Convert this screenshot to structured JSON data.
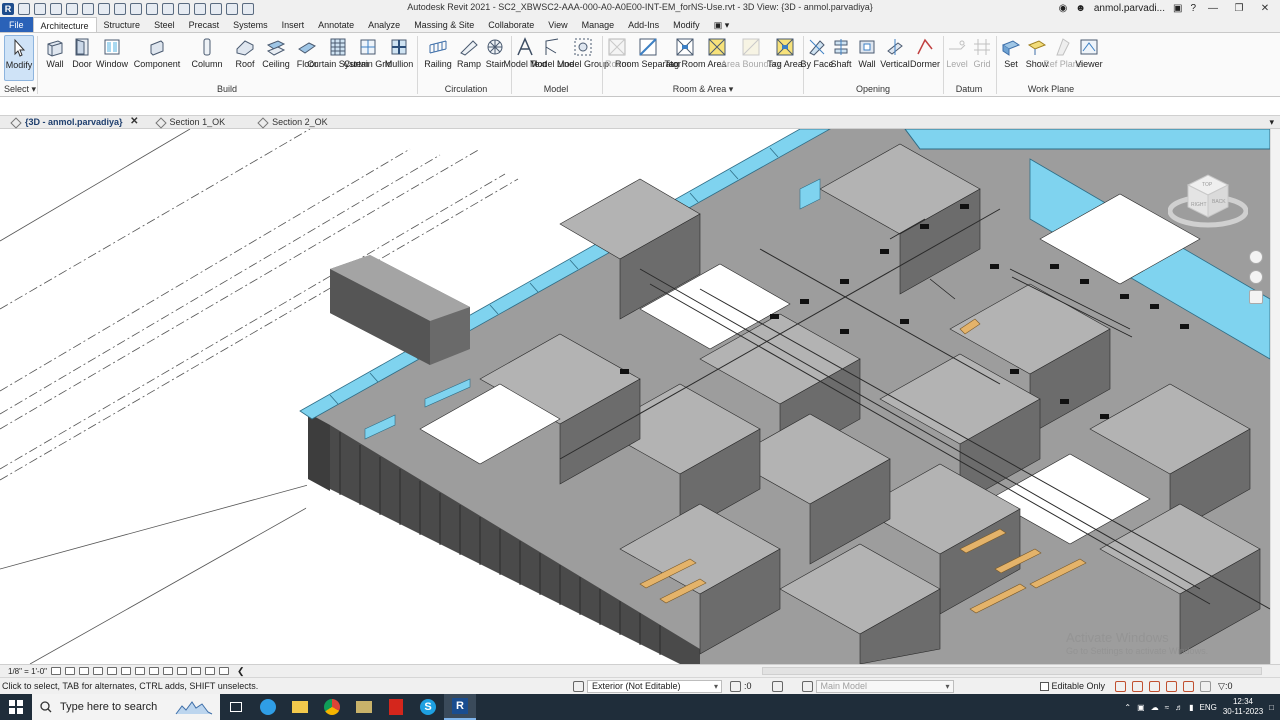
{
  "window": {
    "title": "Autodesk Revit 2021 - SC2_XBWSC2-AAA-000-A0-A0E00-INT-EM_forNS-Use.rvt - 3D View: {3D - anmol.parvadiya}",
    "user": "anmol.parvadi..."
  },
  "ribbon_tabs": [
    "File",
    "Architecture",
    "Structure",
    "Steel",
    "Precast",
    "Systems",
    "Insert",
    "Annotate",
    "Analyze",
    "Massing & Site",
    "Collaborate",
    "View",
    "Manage",
    "Add-Ins",
    "Modify"
  ],
  "active_tab": "Architecture",
  "ribbon": {
    "select": {
      "modify": "Modify",
      "label": "Select"
    },
    "build": {
      "label": "Build",
      "wall": "Wall",
      "door": "Door",
      "window": "Window",
      "component": "Component",
      "column": "Column",
      "roof": "Roof",
      "ceiling": "Ceiling",
      "floor": "Floor",
      "curtain_system": "Curtain System",
      "curtain_grid": "Curtain Grid",
      "mullion": "Mullion"
    },
    "circulation": {
      "label": "Circulation",
      "railing": "Railing",
      "ramp": "Ramp",
      "stair": "Stair"
    },
    "model": {
      "label": "Model",
      "model_text": "Model Text",
      "model_line": "Model Line",
      "model_group": "Model Group"
    },
    "room_area": {
      "label": "Room & Area",
      "room": "Room",
      "room_separator": "Room Separator",
      "tag_room": "Tag Room",
      "area": "Area",
      "area_boundary": "Area Boundary",
      "tag_area": "Tag Area"
    },
    "opening": {
      "label": "Opening",
      "by_face": "By Face",
      "shaft": "Shaft",
      "wall": "Wall",
      "vertical": "Vertical",
      "dormer": "Dormer"
    },
    "datum": {
      "label": "Datum",
      "level": "Level",
      "grid": "Grid"
    },
    "work_plane": {
      "label": "Work Plane",
      "set": "Set",
      "show": "Show",
      "ref_plane": "Ref Plane",
      "viewer": "Viewer"
    }
  },
  "view_tabs": [
    {
      "label": "{3D - anmol.parvadiya}",
      "active": true
    },
    {
      "label": "Section 1_OK",
      "active": false
    },
    {
      "label": "Section 2_OK",
      "active": false
    }
  ],
  "viewcube": {
    "top": "TOP",
    "right": "RIGHT",
    "back": "BACK"
  },
  "watermark": {
    "line1": "Activate Windows",
    "line2": "Go to Settings to activate Windows."
  },
  "view_control": {
    "scale": "1/8\" = 1'-0\""
  },
  "status": {
    "message": "Click to select, TAB for alternates, CTRL adds, SHIFT unselects.",
    "design_option": "Exterior (Not Editable)",
    "selection_count": ":0",
    "model": "Main Model",
    "editable_only": "Editable Only",
    "filter_count": ":0"
  },
  "taskbar": {
    "search_placeholder": "Type here to search",
    "language": "ENG",
    "time": "12:34",
    "date": "30-11-2023"
  },
  "colors": {
    "file_tab": "#2a62b8",
    "wall_top": "#b4b4b4",
    "wall_side": "#5a5a5a",
    "glazing": "#7fd3ef",
    "taskbar": "#1f2d3a"
  }
}
